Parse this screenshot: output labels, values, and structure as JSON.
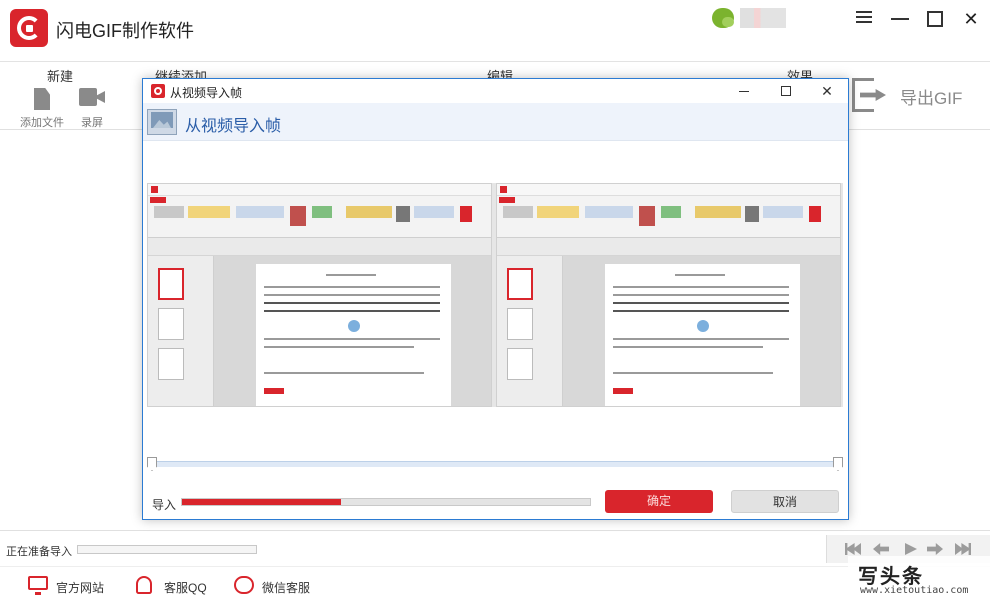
{
  "app": {
    "title": "闪电GIF制作软件"
  },
  "toolbar": {
    "groups": {
      "new": "新建",
      "continue_add": "继续添加",
      "edit": "编辑",
      "effects": "效果"
    },
    "add_file_label": "添加文件",
    "record_label": "录屏",
    "export_label": "导出GIF"
  },
  "dialog": {
    "title": "从视频导入帧",
    "heading": "从视频导入帧",
    "import_label": "导入",
    "import_progress": 0.39,
    "ok_label": "确定",
    "cancel_label": "取消",
    "close_glyph": "✕"
  },
  "status": {
    "text": "正在准备导入"
  },
  "footer": {
    "website": "官方网站",
    "qq": "客服QQ",
    "wechat": "微信客服"
  },
  "watermark": {
    "main": "写头条",
    "url": "www.xietoutiao.com"
  },
  "window": {
    "close_glyph": "✕"
  },
  "colors": {
    "accent": "#d9252c",
    "dialog_border": "#2b7bd3",
    "heading": "#2a5da8"
  },
  "icons": [
    "app-logo-icon",
    "menu-icon",
    "minimize-icon",
    "maximize-icon",
    "close-icon",
    "document-icon",
    "camera-icon",
    "export-icon",
    "film-icon",
    "monitor-icon",
    "bell-icon",
    "chat-icon",
    "first-frame-icon",
    "prev-frame-icon",
    "play-icon",
    "next-frame-icon",
    "last-frame-icon"
  ]
}
